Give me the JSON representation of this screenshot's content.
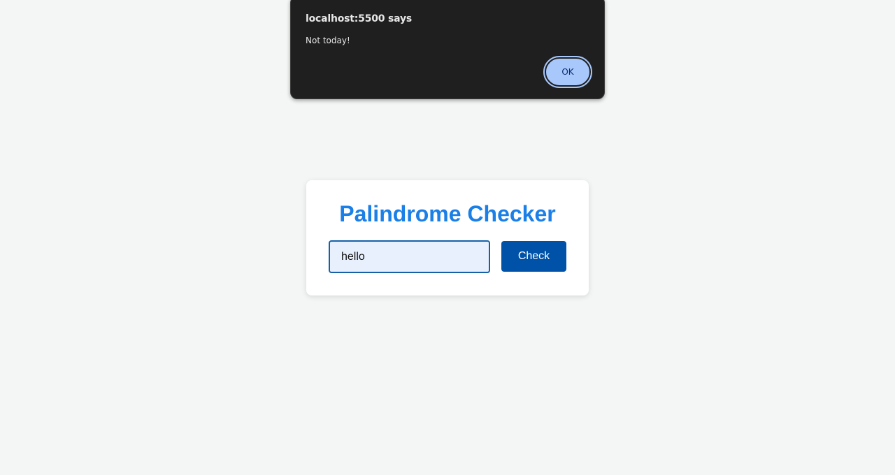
{
  "alert": {
    "title": "localhost:5500 says",
    "message": "Not today!",
    "ok_label": "OK"
  },
  "app": {
    "title": "Palindrome Checker",
    "input_value": "hello",
    "check_label": "Check"
  },
  "colors": {
    "page_background": "#f4f6f5",
    "title_blue": "#1a7fe6",
    "button_blue": "#0052a8",
    "dialog_background": "#1f1f1f",
    "dialog_button": "#a8c7fa"
  }
}
